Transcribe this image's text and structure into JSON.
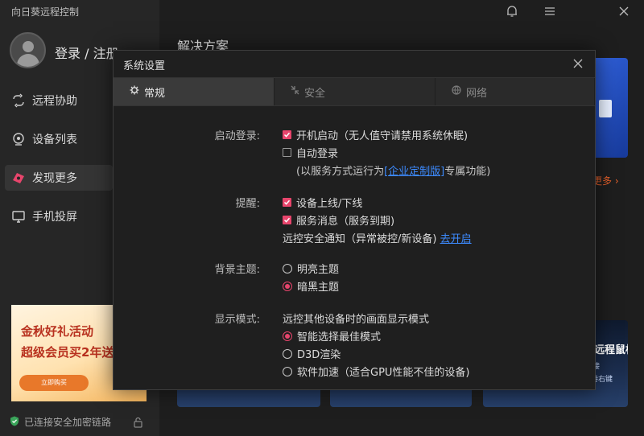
{
  "app": {
    "title": "向日葵远程控制",
    "login_label": "登录 / 注册",
    "nav": [
      {
        "label": "远程协助",
        "icon": "remote-assist-icon"
      },
      {
        "label": "设备列表",
        "icon": "device-list-icon"
      },
      {
        "label": "发现更多",
        "icon": "discover-icon"
      },
      {
        "label": "手机投屏",
        "icon": "screen-mirror-icon"
      }
    ],
    "promo": {
      "line1": "金秋好礼活动",
      "line2": "超级会员买2年送",
      "button": "立即购买"
    },
    "status": "已连接安全加密链路"
  },
  "main": {
    "section_title": "解决方案",
    "more_link": "更多",
    "card3": {
      "title": "远程鼠标",
      "sub1": "接",
      "sub2": "持右键"
    }
  },
  "dialog": {
    "title": "系统设置",
    "tabs": [
      {
        "label": "常规",
        "icon": "gear-icon",
        "active": true
      },
      {
        "label": "安全",
        "icon": "security-icon",
        "active": false
      },
      {
        "label": "网络",
        "icon": "network-icon",
        "active": false
      }
    ],
    "startup": {
      "label": "启动登录:",
      "boot_start": {
        "label": "开机启动（无人值守请禁用系统休眠)",
        "checked": true
      },
      "auto_login": {
        "label": "自动登录",
        "checked": false
      },
      "note_prefix": "(以服务方式运行为",
      "note_link": "[企业定制版]",
      "note_suffix": "专属功能)"
    },
    "reminder": {
      "label": "提醒:",
      "online_offline": {
        "label": "设备上线/下线",
        "checked": true
      },
      "service_msg": {
        "label": "服务消息（服务到期)",
        "checked": true
      },
      "security_notice_text": "远控安全通知（异常被控/新设备)",
      "security_notice_link": "去开启"
    },
    "theme": {
      "label": "背景主题:",
      "options": [
        {
          "label": "明亮主题",
          "checked": false
        },
        {
          "label": "暗黑主题",
          "checked": true
        }
      ]
    },
    "display": {
      "label": "显示模式:",
      "desc": "远控其他设备时的画面显示模式",
      "options": [
        {
          "label": "智能选择最佳模式",
          "checked": true
        },
        {
          "label": "D3D渲染",
          "checked": false
        },
        {
          "label": "软件加速（适合GPU性能不佳的设备)",
          "checked": false
        }
      ]
    }
  },
  "colors": {
    "accent": "#e8456c",
    "link": "#3d8bff",
    "more": "#e8612c"
  }
}
